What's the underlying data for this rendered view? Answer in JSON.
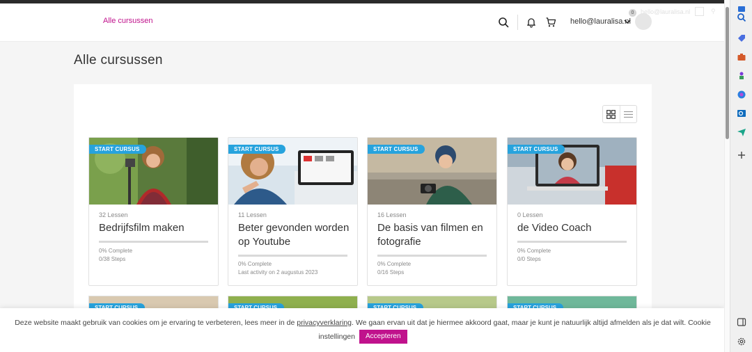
{
  "header": {
    "nav_link": "Alle cursussen",
    "email": "hello@lauralisa.nl",
    "notification_count": "0",
    "ghost_email": "hello@lauralisa.nl"
  },
  "page": {
    "title": "Alle cursussen"
  },
  "courses": [
    {
      "ribbon": "START CURSUS",
      "lessons": "32 Lessen",
      "title": "Bedrijfsfilm maken",
      "complete": "0% Complete",
      "progress_percent": 0,
      "line2": "0/38 Steps",
      "line3": ""
    },
    {
      "ribbon": "START CURSUS",
      "lessons": "11 Lessen",
      "title": "Beter gevonden worden op Youtube",
      "complete": "0% Complete",
      "progress_percent": 0,
      "line2": "Last activity on 2 augustus 2023",
      "line3": ""
    },
    {
      "ribbon": "START CURSUS",
      "lessons": "16 Lessen",
      "title": "De basis van filmen en fotografie",
      "complete": "0% Complete",
      "progress_percent": 0,
      "line2": "0/16 Steps",
      "line3": ""
    },
    {
      "ribbon": "START CURSUS",
      "lessons": "0 Lessen",
      "title": "de Video Coach",
      "complete": "0% Complete",
      "progress_percent": 0,
      "line2": "0/0 Steps",
      "line3": ""
    }
  ],
  "courses_row2": [
    {
      "ribbon": "START CURSUS"
    },
    {
      "ribbon": "START CURSUS"
    },
    {
      "ribbon": "START CURSUS"
    },
    {
      "ribbon": "START CURSUS"
    }
  ],
  "cookie": {
    "text_before": "Deze website maakt gebruik van cookies om je ervaring te verbeteren, lees meer in de ",
    "link": "privacyverklaring",
    "text_after": ". We gaan ervan uit dat je hiermee akkoord gaat, maar je kunt je natuurlijk altijd afmelden als je dat wilt. Cookie instellingen",
    "accept": "Accepteren"
  },
  "colors": {
    "brand": "#c0128c",
    "ribbon": "#27a3dd"
  },
  "icons": [
    "search-icon",
    "bell-icon",
    "cart-icon",
    "chevron-down-icon",
    "grid-view-icon",
    "list-view-icon"
  ]
}
